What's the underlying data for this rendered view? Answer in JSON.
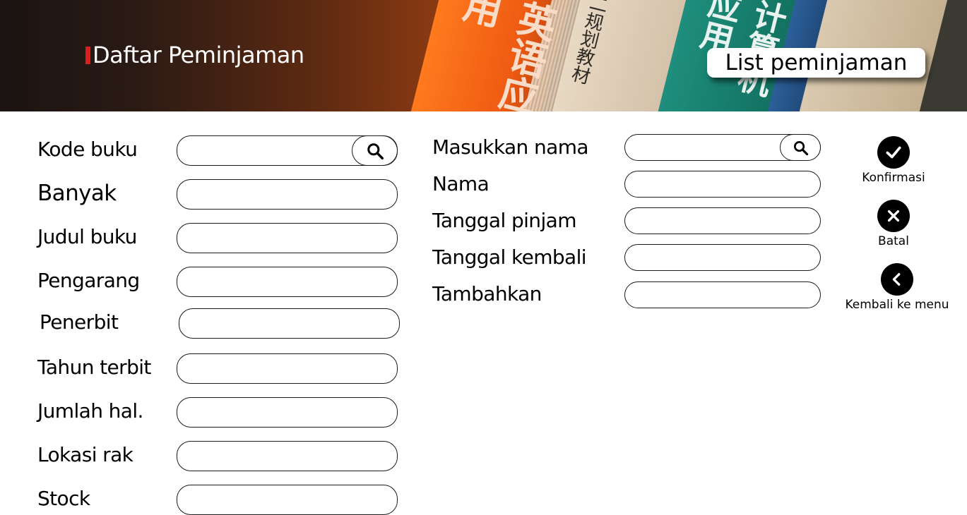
{
  "header": {
    "title": "Daftar Peminjaman",
    "list_button": "List peminjaman",
    "book_text_1": "英语应用",
    "book_text_2": "二规划教材",
    "book_text_3": "计算机应用"
  },
  "book_form": {
    "kode_buku": "Kode buku",
    "banyak": "Banyak",
    "judul_buku": "Judul buku",
    "pengarang": "Pengarang",
    "penerbit": "Penerbit",
    "tahun_terbit": "Tahun terbit",
    "jumlah_hal": "Jumlah hal.",
    "lokasi_rak": "Lokasi rak",
    "stock": "Stock"
  },
  "borrower_form": {
    "masukkan_nama": "Masukkan nama",
    "nama": "Nama",
    "tanggal_pinjam": "Tanggal pinjam",
    "tanggal_kembali": "Tanggal kembali",
    "tambahkan": "Tambahkan"
  },
  "actions": {
    "confirm": "Konfirmasi",
    "cancel": "Batal",
    "back": "Kembali ke menu"
  },
  "colors": {
    "accent": "#e01d1d",
    "button_fill": "#000000"
  },
  "icons": [
    "search-icon",
    "check-icon",
    "close-icon",
    "chevron-left-icon"
  ]
}
